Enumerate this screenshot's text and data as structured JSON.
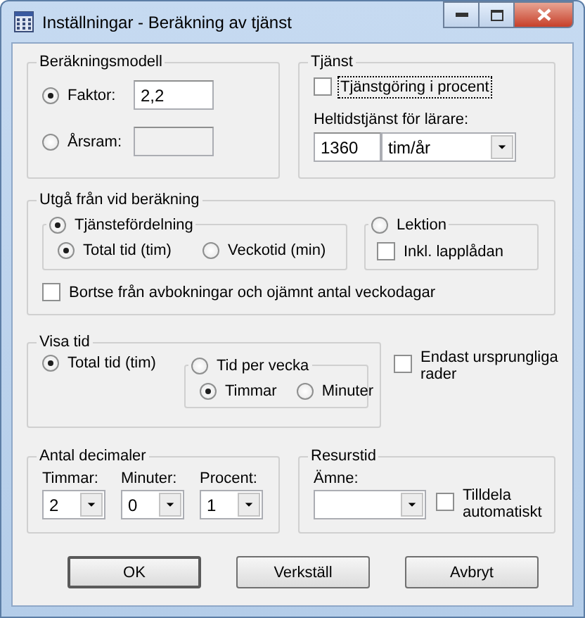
{
  "window": {
    "title": "Inställningar - Beräkning av tjänst"
  },
  "calculation_model": {
    "title": "Beräkningsmodell",
    "options": [
      {
        "label": "Faktor:",
        "selected": true,
        "disabled": false,
        "value": "2,2"
      },
      {
        "label": "Årsram:",
        "selected": false,
        "disabled": true
      }
    ]
  },
  "service": {
    "title": "Tjänst",
    "percent_checkbox": {
      "label": "Tjänstgöring i procent",
      "checked": false,
      "focused": true
    },
    "fulltime_label": "Heltidstjänst för lärare:",
    "fulltime_value": "1360",
    "unit": "tim/år"
  },
  "basis": {
    "title": "Utgå från vid beräkning",
    "distribution": {
      "label": "Tjänstefördelning",
      "selected": true,
      "options": [
        {
          "label": "Total tid (tim)",
          "selected": true
        },
        {
          "label": "Veckotid (min)",
          "selected": false
        }
      ]
    },
    "lesson": {
      "label": "Lektion",
      "selected": false,
      "checkbox": {
        "label": "Inkl. lapplådan",
        "checked": false
      }
    },
    "ignore_checkbox": {
      "label": "Bortse från avbokningar och ojämnt antal veckodagar",
      "checked": false
    }
  },
  "show_time": {
    "title": "Visa tid",
    "total": {
      "label": "Total tid (tim)",
      "selected": true
    },
    "per_week": {
      "label": "Tid per vecka",
      "selected": false,
      "options": [
        {
          "label": "Timmar",
          "selected": true
        },
        {
          "label": "Minuter",
          "selected": false
        }
      ]
    }
  },
  "original_rows_checkbox": {
    "label": "Endast ursprungliga rader",
    "checked": false
  },
  "decimals": {
    "title": "Antal decimaler",
    "fields": [
      {
        "label": "Timmar:",
        "value": "2"
      },
      {
        "label": "Minuter:",
        "value": "0"
      },
      {
        "label": "Procent:",
        "value": "1"
      }
    ]
  },
  "resource_time": {
    "title": "Resurstid",
    "subject_label": "Ämne:",
    "auto_checkbox": {
      "label": "Tilldela automatiskt",
      "checked": false
    }
  },
  "buttons": [
    {
      "label": "OK",
      "default": true
    },
    {
      "label": "Verkställ",
      "default": false
    },
    {
      "label": "Avbryt",
      "default": false
    }
  ]
}
